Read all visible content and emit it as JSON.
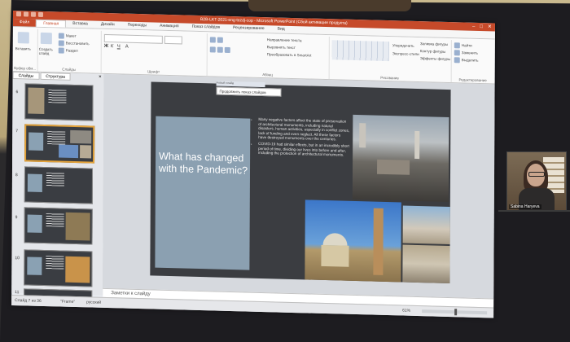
{
  "app": {
    "window_title": "В2В-LKT-2021-eng-tezdj-cop - Microsoft PowerPoint (Сбой активации продукта)",
    "file_tab": "Файл",
    "tabs": [
      "Главная",
      "Вставка",
      "Дизайн",
      "Переходы",
      "Анимация",
      "Показ слайдов",
      "Рецензирование",
      "Вид"
    ]
  },
  "ribbon": {
    "paste": "Вставить",
    "create_slide": "Создать слайд",
    "layout": "Макет",
    "reset": "Восстановить",
    "section": "Раздел",
    "clipboard_label": "Буфер обм...",
    "slides_label": "Слайды",
    "font_label": "Шрифт",
    "paragraph_label": "Абзац",
    "drawing_label": "Рисование",
    "editing_label": "Редактирование",
    "arrange": "Упорядочить",
    "quick_styles": "Экспресс-стили",
    "shape_fill": "Заливка фигуры",
    "shape_outline": "Контур фигуры",
    "shape_effects": "Эффекты фигуры",
    "find": "Найти",
    "replace": "Заменить",
    "select": "Выделить",
    "text_direction": "Направление текста",
    "align_text": "Выровнять текст",
    "smartart": "Преобразовать в SmartArt"
  },
  "left_pane": {
    "tab_slides": "Слайды",
    "tab_outline": "Структура",
    "close": "×",
    "slide_numbers": [
      "6",
      "7",
      "8",
      "9",
      "10",
      "11"
    ]
  },
  "slide": {
    "title": "What has changed with the Pandemic?",
    "bullets": [
      "Many negative factors affect the state of preservation of architectural monuments, including natural disasters, human activities, especially in conflict zones, lack of funding and even neglect. All these factors have destroyed monuments over the centuries.",
      "COVID-19 had similar effects, but in an incredibly short period of time, dividing our lives into before and after, including the protection of architectural monuments."
    ]
  },
  "tooltip": {
    "small": "Новый слайд",
    "text": "Продолжить показ слайдов"
  },
  "notes": {
    "placeholder": "Заметки к слайду"
  },
  "status": {
    "slide_counter": "Слайд 7 из 36",
    "theme": "\"Frame\"",
    "language": "русский",
    "zoom": "61%"
  },
  "camera": {
    "name": "Sabina Haryeva"
  },
  "colors": {
    "accent": "#c64a2a",
    "slide_bg": "#3b3d41",
    "title_box": "#8ba0b1"
  }
}
